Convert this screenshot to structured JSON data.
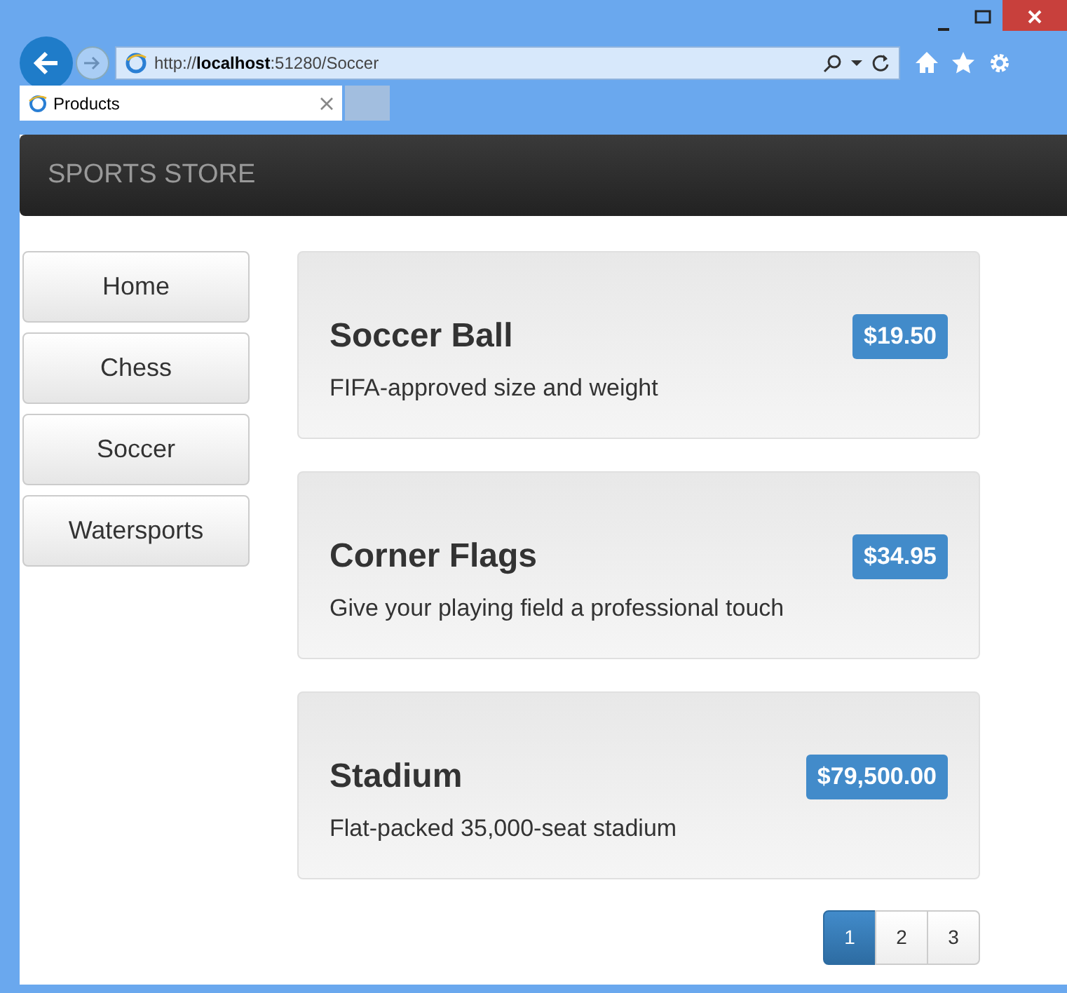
{
  "browser": {
    "address": "http://**localhost**:51280/Soccer",
    "tabs": [
      {
        "title": "Products",
        "selected": true
      }
    ]
  },
  "navbar": {
    "brand": "SPORTS STORE"
  },
  "categories": [
    {
      "label": "Home",
      "selected": false
    },
    {
      "label": "Chess",
      "selected": false
    },
    {
      "label": "Soccer",
      "selected": false
    },
    {
      "label": "Watersports",
      "selected": false
    }
  ],
  "products": [
    {
      "name": "Soccer Ball",
      "price": "$19.50",
      "description": "FIFA-approved size and weight"
    },
    {
      "name": "Corner Flags",
      "price": "$34.95",
      "description": "Give your playing field a professional touch"
    },
    {
      "name": "Stadium",
      "price": "$79,500.00",
      "description": "Flat-packed 35,000-seat stadium"
    }
  ],
  "pagination": [
    {
      "label": "1",
      "selected": true
    },
    {
      "label": "2",
      "selected": false
    },
    {
      "label": "3",
      "selected": false
    }
  ]
}
